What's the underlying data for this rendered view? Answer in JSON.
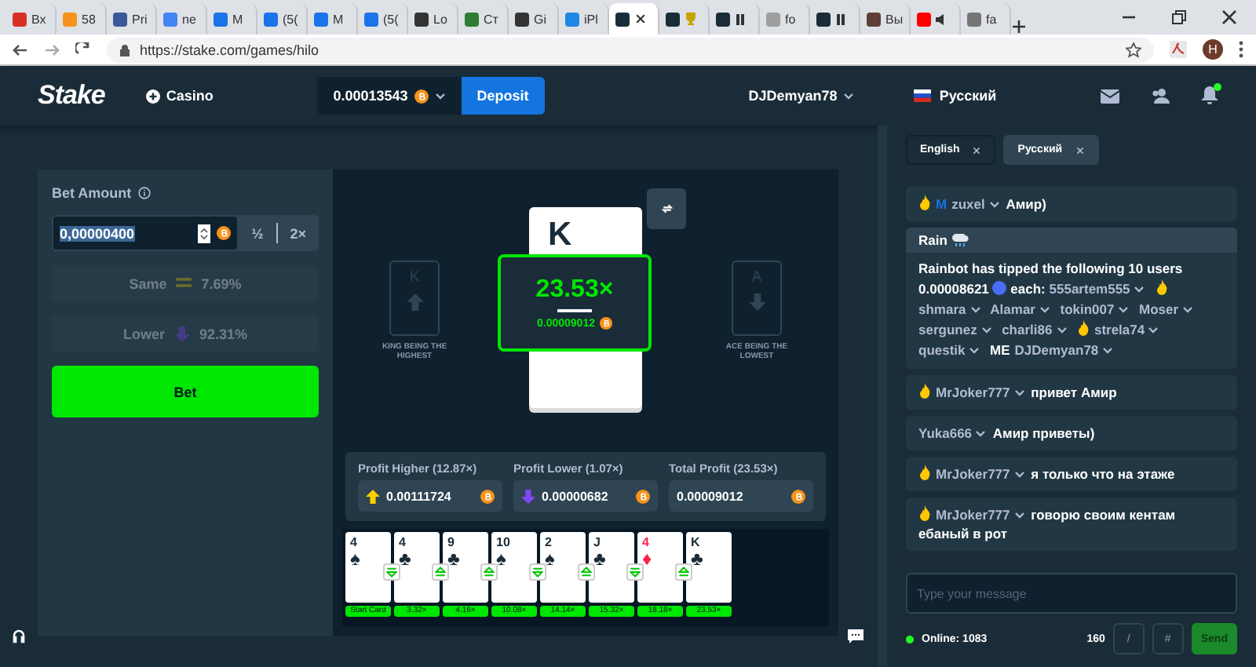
{
  "browser": {
    "tabs": [
      {
        "label": "Вх",
        "color": "#d93025",
        "selected": false
      },
      {
        "label": "58",
        "color": "#f7931a",
        "selected": false
      },
      {
        "label": "Pri",
        "color": "#3b5998",
        "selected": false
      },
      {
        "label": "ne",
        "color": "#4285f4",
        "selected": false
      },
      {
        "label": "M",
        "color": "#1a73e8",
        "selected": false
      },
      {
        "label": "(5(",
        "color": "#1a73e8",
        "selected": false
      },
      {
        "label": "M",
        "color": "#1a73e8",
        "selected": false
      },
      {
        "label": "(5(",
        "color": "#1a73e8",
        "selected": false
      },
      {
        "label": "Lo",
        "color": "#333333",
        "selected": false
      },
      {
        "label": "Ст",
        "color": "#2e7d32",
        "selected": false
      },
      {
        "label": "Gi",
        "color": "#333333",
        "selected": false
      },
      {
        "label": "iPl",
        "color": "#1e88e5",
        "selected": false
      },
      {
        "color": "#1a2c38",
        "selected": true
      },
      {
        "color": "#1a2c38",
        "kind": "trophy",
        "selected": false
      },
      {
        "color": "#1a2c38",
        "kind": "pause",
        "selected": false
      },
      {
        "label": "fo",
        "color": "#9e9e9e",
        "selected": false
      },
      {
        "color": "#1a2c38",
        "kind": "pause",
        "selected": false
      },
      {
        "label": "Вы",
        "color": "#5d4037",
        "selected": false
      },
      {
        "color": "#ff0000",
        "kind": "muted",
        "selected": false
      },
      {
        "label": "fa",
        "color": "#757575",
        "selected": false
      }
    ],
    "url": "https://stake.com/games/hilo",
    "profile_initial": "H"
  },
  "header": {
    "logo": "Stake",
    "casino": "Casino",
    "balance": "0.00013543",
    "deposit": "Deposit",
    "username": "DJDemyan78",
    "language": "Русский",
    "notification_dot": true
  },
  "bet": {
    "label": "Bet Amount",
    "value": "0,00000400",
    "half": "½",
    "double": "2×",
    "options": [
      {
        "kind": "same",
        "label": "Same",
        "chance": "7.69%",
        "disabled": true
      },
      {
        "kind": "lower",
        "label": "Lower",
        "chance": "92.31%",
        "disabled": true
      }
    ],
    "button": "Bet"
  },
  "game": {
    "left_hint": {
      "rank": "K",
      "kind": "up",
      "caption": "KING BEING THE HIGHEST"
    },
    "right_hint": {
      "rank": "A",
      "kind": "down",
      "caption": "ACE BEING THE LOWEST"
    },
    "current_card": "K",
    "multiplier": "23.53×",
    "payout": "0.00009012",
    "profits": [
      {
        "kind": "higher",
        "label": "Profit Higher (12.87×)",
        "value": "0.00111724"
      },
      {
        "kind": "lower",
        "label": "Profit Lower (1.07×)",
        "value": "0.00000682"
      },
      {
        "kind": "total",
        "label": "Total Profit (23.53×)",
        "value": "0.00009012"
      }
    ],
    "history": [
      {
        "rank": "4",
        "suit": "♠",
        "red": false,
        "kind": "start",
        "label": "Start Card"
      },
      {
        "rank": "4",
        "suit": "♣",
        "red": false,
        "kind": "lower",
        "label": "3.32×"
      },
      {
        "rank": "9",
        "suit": "♣",
        "red": false,
        "kind": "higher",
        "label": "4.16×"
      },
      {
        "rank": "10",
        "suit": "♠",
        "red": false,
        "kind": "higher",
        "label": "10.08×"
      },
      {
        "rank": "2",
        "suit": "♠",
        "red": false,
        "kind": "lower",
        "label": "14.14×"
      },
      {
        "rank": "J",
        "suit": "♣",
        "red": false,
        "kind": "higher",
        "label": "15.32×"
      },
      {
        "rank": "4",
        "suit": "♦",
        "red": true,
        "kind": "lower",
        "label": "18.18×"
      },
      {
        "rank": "K",
        "suit": "♣",
        "red": false,
        "kind": "higher",
        "label": "23.53×"
      }
    ]
  },
  "chat": {
    "tabs": [
      {
        "label": "English",
        "selected": true
      },
      {
        "label": "Русский",
        "selected": false
      }
    ],
    "messages": [
      {
        "kind": "message",
        "flame": true,
        "badge": "M",
        "user": "zuxel",
        "text": "Амир)"
      },
      {
        "kind": "rain",
        "title": "Rain",
        "intro": "Rainbot has tipped the following 10 users",
        "amount": "0.00008621",
        "each": "each:",
        "users": [
          {
            "name": "555artem555",
            "flame": false
          },
          {
            "name": "shmara",
            "flame": true
          },
          {
            "name": "Alamar",
            "flame": false
          },
          {
            "name": "tokin007",
            "flame": false
          },
          {
            "name": "Moser",
            "flame": false
          },
          {
            "name": "sergunez",
            "flame": false
          },
          {
            "name": "charli86",
            "flame": false
          },
          {
            "name": "strela74",
            "flame": true
          },
          {
            "name": "questik",
            "flame": false
          },
          {
            "name": "DJDemyan78",
            "flame": false,
            "badge": "ME"
          }
        ]
      },
      {
        "kind": "message",
        "flame": true,
        "user": "MrJoker777",
        "text": "привет Амир"
      },
      {
        "kind": "message",
        "flame": false,
        "user": "Yuka666",
        "text": "Амир приветы)"
      },
      {
        "kind": "message",
        "flame": true,
        "user": "MrJoker777",
        "text": "я только что на этаже"
      },
      {
        "kind": "message",
        "flame": true,
        "user": "MrJoker777",
        "text": "говорю своим кентам ебаный в рот"
      }
    ],
    "placeholder": "Type your message",
    "online": "Online: 1083",
    "char_count": "160",
    "slash": "/",
    "hash": "#",
    "send": "Send"
  }
}
